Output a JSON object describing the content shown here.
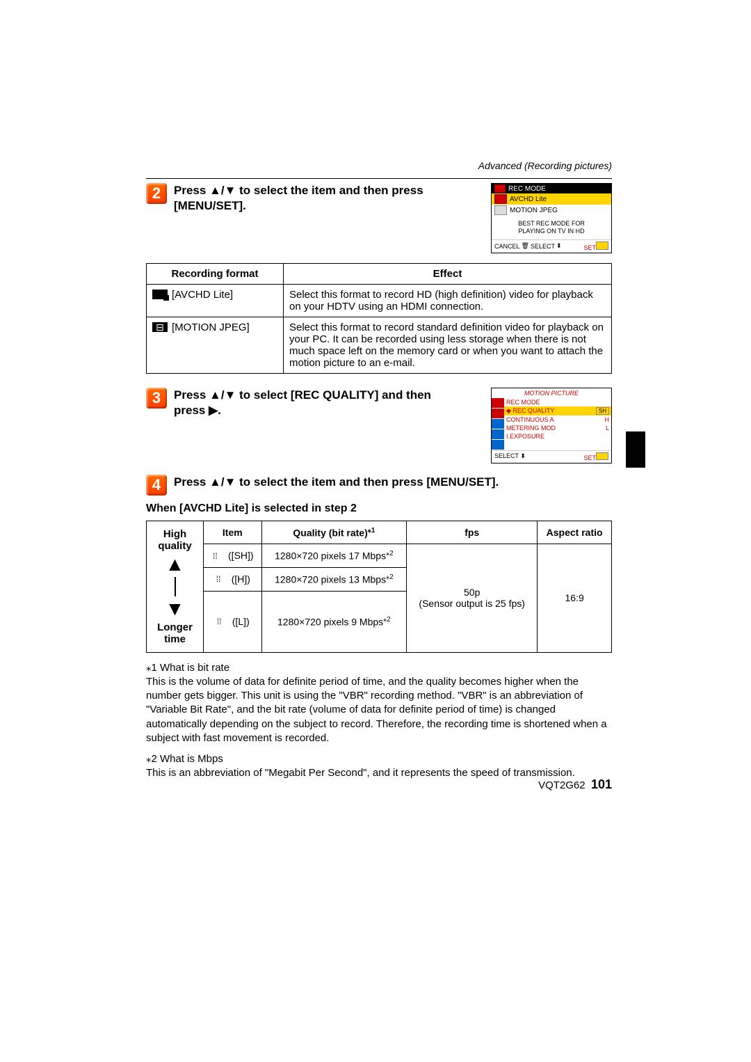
{
  "header": {
    "section": "Advanced (Recording pictures)"
  },
  "steps": {
    "s2": {
      "num": "2",
      "text_a": "Press ▲/▼ to select the item and then press ",
      "text_b": "[MENU/SET]."
    },
    "s3": {
      "num": "3",
      "text_a": "Press ▲/▼ to select [REC QUALITY] and then ",
      "text_b": "press ▶."
    },
    "s4": {
      "num": "4",
      "text": "Press ▲/▼ to select the item and then press [MENU/SET]."
    }
  },
  "screenshot1": {
    "title": "REC MODE",
    "row1": "AVCHD Lite",
    "row2": "MOTION JPEG",
    "desc1": "BEST REC MODE FOR",
    "desc2": "PLAYING ON TV IN HD",
    "cancel": "CANCEL",
    "select": "SELECT",
    "set": "SET"
  },
  "format_table": {
    "h1": "Recording format",
    "h2": "Effect",
    "r1_name": "[AVCHD Lite]",
    "r1_effect": "Select this format to record HD (high definition) video for playback on your HDTV using an HDMI connection.",
    "r2_name": "[MOTION JPEG]",
    "r2_effect": "Select this format to record standard definition video for playback on your PC. It can be recorded using less storage when there is not much space left on the memory card or when you want to attach the motion picture to an e-mail."
  },
  "screenshot2": {
    "title": "MOTION PICTURE",
    "r1": "REC MODE",
    "r2": "REC QUALITY",
    "r2_badge": "SH",
    "r3": "CONTINUOUS A",
    "r3_badge": "H",
    "r4": "METERING MOD",
    "r4_badge": "L",
    "r5": "I.EXPOSURE",
    "select": "SELECT",
    "set": "SET"
  },
  "subhead": "When [AVCHD Lite] is selected in step 2",
  "quality_left": {
    "top": "High quality",
    "bottom": "Longer time"
  },
  "quality_headers": {
    "item": "Item",
    "quality": "Quality (bit rate)",
    "quality_sup": "⁎1",
    "fps": "fps",
    "aspect": "Aspect ratio"
  },
  "quality_rows": [
    {
      "item": "([SH])",
      "quality": "1280×720 pixels 17 Mbps",
      "sup": "⁎2"
    },
    {
      "item": "([H])",
      "quality": "1280×720 pixels 13 Mbps",
      "sup": "⁎2"
    },
    {
      "item": "([L])",
      "quality": "1280×720 pixels 9 Mbps",
      "sup": "⁎2"
    }
  ],
  "quality_fps": "50p\n(Sensor output is 25 fps)",
  "quality_aspect": "16:9",
  "notes": {
    "n1_label": "⁎1 What is bit rate",
    "n1_body": "This is the volume of data for definite period of time, and the quality becomes higher when the number gets bigger. This unit is using the \"VBR\" recording method. \"VBR\" is an abbreviation of \"Variable Bit Rate\", and the bit rate (volume of data for definite period of time) is changed automatically depending on the subject to record. Therefore, the recording time is shortened when a subject with fast movement is recorded.",
    "n2_label": "⁎2 What is Mbps",
    "n2_body": "This is an abbreviation of \"Megabit Per Second\", and it represents the speed of transmission."
  },
  "footer": {
    "code": "VQT2G62",
    "page": "101"
  }
}
